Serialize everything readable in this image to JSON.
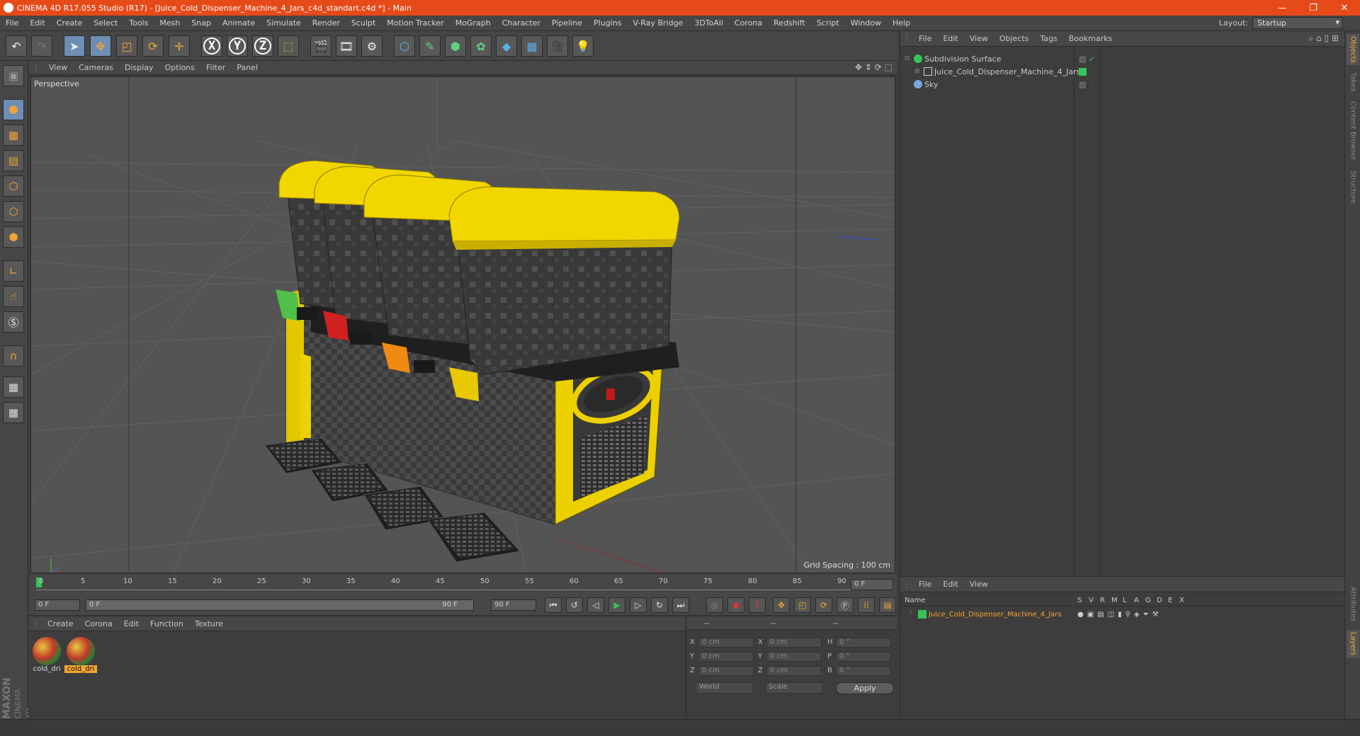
{
  "app": {
    "title": "CINEMA 4D R17.055 Studio (R17) - [Juice_Cold_Dispenser_Machine_4_Jars_c4d_standart.c4d *] - Main"
  },
  "menu": [
    "File",
    "Edit",
    "Create",
    "Select",
    "Tools",
    "Mesh",
    "Snap",
    "Animate",
    "Simulate",
    "Render",
    "Sculpt",
    "Motion Tracker",
    "MoGraph",
    "Character",
    "Pipeline",
    "Plugins",
    "V-Ray Bridge",
    "3DToAll",
    "Corona",
    "Redshift",
    "Script",
    "Window",
    "Help"
  ],
  "layout": {
    "label": "Layout:",
    "value": "Startup"
  },
  "viewport": {
    "menu": [
      "View",
      "Cameras",
      "Display",
      "Options",
      "Filter",
      "Panel"
    ],
    "camera": "Perspective",
    "grid_spacing": "Grid Spacing : 100 cm"
  },
  "timeline": {
    "ticks": [
      "0",
      "5",
      "10",
      "15",
      "20",
      "25",
      "30",
      "35",
      "40",
      "45",
      "50",
      "55",
      "60",
      "65",
      "70",
      "75",
      "80",
      "85",
      "90"
    ],
    "current_frame": "0 F",
    "start_field": "0 F",
    "range_start": "0 F",
    "range_end": "90 F",
    "end_field": "90 F"
  },
  "material_panel": {
    "menu": [
      "Create",
      "Corona",
      "Edit",
      "Function",
      "Texture"
    ],
    "materials": [
      {
        "name": "cold_dri",
        "selected": false
      },
      {
        "name": "cold_dri",
        "selected": true
      }
    ]
  },
  "coordinates": {
    "headers": [
      "--",
      "--",
      "--"
    ],
    "rows": [
      {
        "a": "X",
        "av": "0 cm",
        "b": "X",
        "bv": "0 cm",
        "c": "H",
        "cv": "0 °"
      },
      {
        "a": "Y",
        "av": "0 cm",
        "b": "Y",
        "bv": "0 cm",
        "c": "P",
        "cv": "0 °"
      },
      {
        "a": "Z",
        "av": "0 cm",
        "b": "Z",
        "bv": "0 cm",
        "c": "B",
        "cv": "0 °"
      }
    ],
    "mode1": "World",
    "mode2": "Scale",
    "apply": "Apply"
  },
  "objects_panel": {
    "menu": [
      "File",
      "Edit",
      "View",
      "Objects",
      "Tags",
      "Bookmarks"
    ],
    "items": [
      {
        "name": "Subdivision Surface",
        "indent": 0
      },
      {
        "name": "Juice_Cold_Dispenser_Machine_4_Jars",
        "indent": 1
      },
      {
        "name": "Sky",
        "indent": 0
      }
    ]
  },
  "layers_panel": {
    "menu": [
      "File",
      "Edit",
      "View"
    ],
    "headers": [
      "Name",
      "S",
      "V",
      "R",
      "M",
      "L",
      "A",
      "G",
      "D",
      "E",
      "X"
    ],
    "layer": "Juice_Cold_Dispenser_Machine_4_Jars"
  },
  "side_tabs": [
    "Objects",
    "Takes",
    "Content Browser",
    "Structure"
  ],
  "side_tabs_bottom": [
    "Attributes",
    "Layers"
  ],
  "brand": {
    "top": "MAXON",
    "bottom": "CINEMA 4D"
  },
  "colors": {
    "titlebar": "#e64a19",
    "accent": "#f3a433",
    "jar_lid": "#f2d600"
  }
}
